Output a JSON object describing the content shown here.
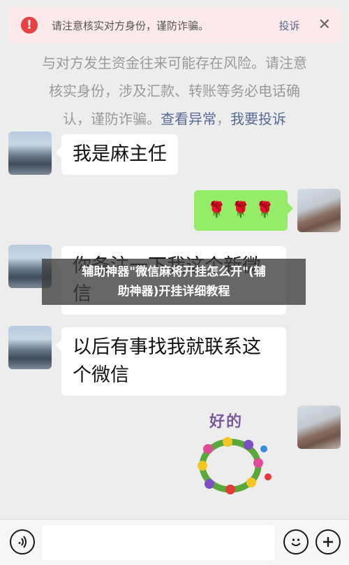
{
  "warning": {
    "icon": "!",
    "text": "请注意核实对方身份，谨防诈骗。",
    "report_label": "投诉",
    "close_icon": "✕"
  },
  "notice": {
    "line1": "与对方发生资金往来可能存在风险。请注意",
    "line2": "核实身份，涉及汇款、转账等务必电话确",
    "line3_prefix": "认，谨防诈骗。",
    "link_anomaly": "查看异常",
    "link_report": "我要投诉"
  },
  "messages": {
    "m1": "我是麻主任",
    "m2": "🌹 🌹 🌹",
    "m3_line1": "你备注一下我这个新微",
    "m3_line2": "信",
    "m4_line1": "以后有事找我就联系这",
    "m4_line2": "个微信",
    "sticker_text": "好的"
  },
  "overlay": {
    "line1": "辅助神器\"微信麻将开挂怎么开\"(辅",
    "line2": "助神器)开挂详细教程"
  },
  "bottom_bar": {
    "voice_icon": "voice-icon",
    "emoji_icon": "emoji-icon",
    "plus_icon": "plus-icon"
  }
}
